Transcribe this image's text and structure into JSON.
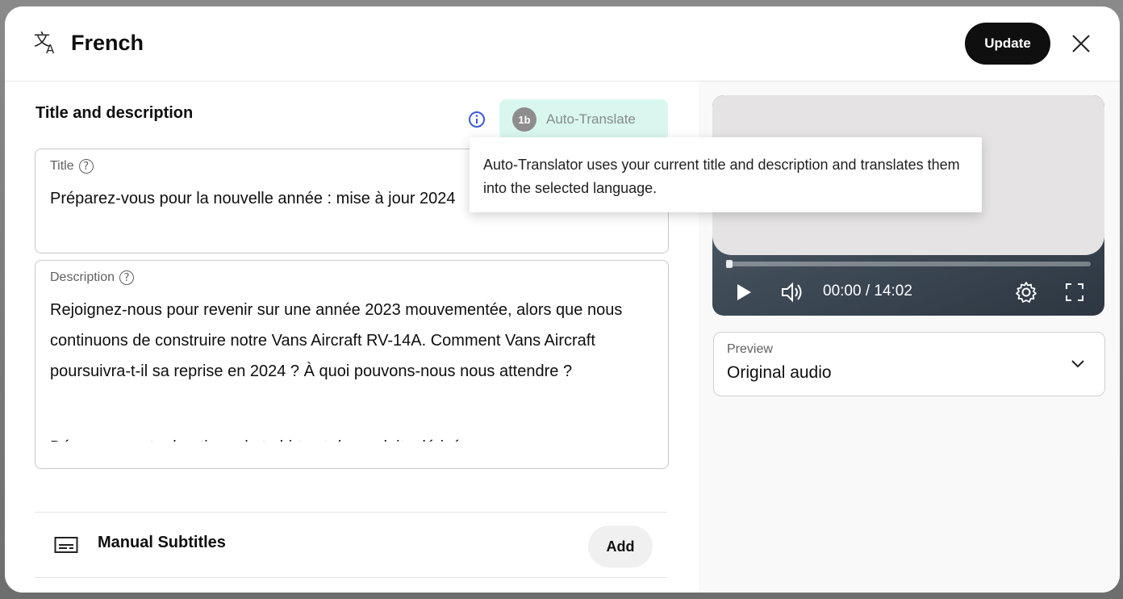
{
  "header": {
    "language_icon": "translate-icon",
    "title": "French",
    "update_label": "Update",
    "close_icon": "close-icon"
  },
  "title_and_description": {
    "section_title": "Title and description",
    "info_icon": "info-icon",
    "auto_translate": {
      "logo_text": "1b",
      "label": "Auto-Translate"
    },
    "title_field": {
      "label": "Title",
      "value": "Préparez-vous pour la nouvelle année : mise à jour 2024"
    },
    "description_field": {
      "label": "Description",
      "value": "Rejoignez-nous pour revenir sur une année 2023 mouvementée, alors que nous continuons de construire notre Vans Aircraft RV-14A. Comment Vans Aircraft poursuivra-t-il sa reprise en 2024 ? À quoi pouvons-nous nous attendre ?",
      "cut_line": "Découvrez notre boutique de t-shirts et de produits dérivés :"
    }
  },
  "subtitles": {
    "icon": "subtitles-icon",
    "label": "Manual Subtitles",
    "add_label": "Add"
  },
  "video": {
    "time": "00:00 / 14:02",
    "progress": 0,
    "play_icon": "play-icon",
    "volume_icon": "volume-icon",
    "settings_icon": "settings-gear-icon",
    "fullscreen_icon": "fullscreen-icon"
  },
  "preview": {
    "label": "Preview",
    "value": "Original audio"
  },
  "tooltip": {
    "text": "Auto-Translator uses your current title and description and translates them into the selected language."
  },
  "colors": {
    "update_button": "#0f0f0f",
    "auto_translate_bg": "#d9f7ef",
    "info_icon": "#3b5bdb"
  }
}
